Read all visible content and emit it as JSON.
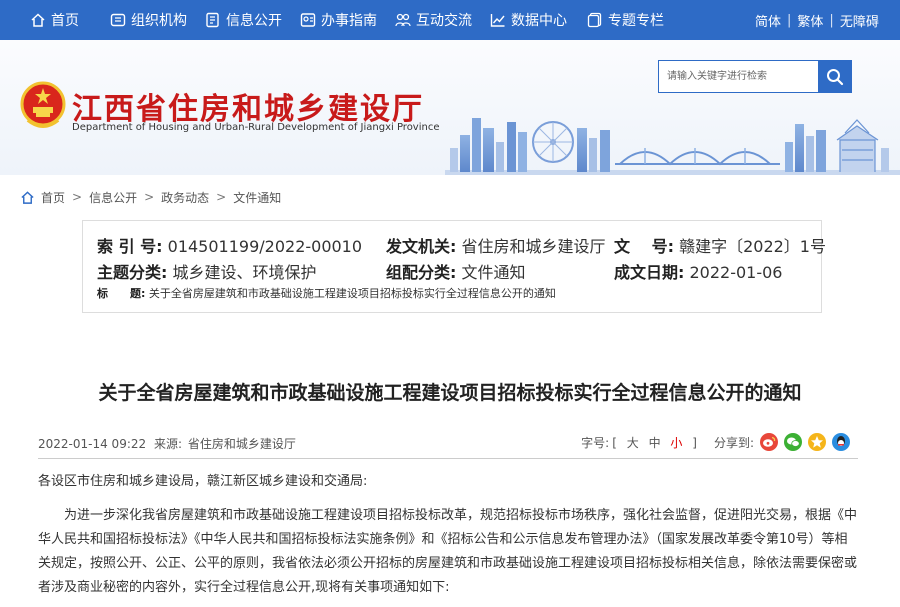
{
  "nav": {
    "items": [
      {
        "label": "首页",
        "icon": "home-icon"
      },
      {
        "label": "组织机构",
        "icon": "org-icon"
      },
      {
        "label": "信息公开",
        "icon": "document-icon"
      },
      {
        "label": "办事指南",
        "icon": "guide-icon"
      },
      {
        "label": "互动交流",
        "icon": "interact-icon"
      },
      {
        "label": "数据中心",
        "icon": "chart-icon"
      },
      {
        "label": "专题专栏",
        "icon": "topic-icon"
      }
    ],
    "lang": {
      "simplified": "简体",
      "traditional": "繁体",
      "accessible": "无障碍"
    },
    "accent": "#2e6bc6"
  },
  "header": {
    "title": "江西省住房和城乡建设厅",
    "subtitle": "Department of Housing and Urban-Rural Development of Jiangxi Province",
    "search_placeholder": "请输入关键字进行检索",
    "title_color": "#c81a1a"
  },
  "breadcrumb": [
    "首页",
    "信息公开",
    "政务动态",
    "文件通知"
  ],
  "info": {
    "index_label": "索 引 号:",
    "index_value": "014501199/2022-00010",
    "issuer_label": "发文机关:",
    "issuer_value": "省住房和城乡建设厅",
    "docno_label": "文　 号:",
    "docno_value": "赣建字〔2022〕1号",
    "topic_label": "主题分类:",
    "topic_value": "城乡建设、环境保护",
    "orgtype_label": "组配分类:",
    "orgtype_value": "文件通知",
    "date_label": "成文日期:",
    "date_value": "2022-01-06",
    "subject_label": "标　　题:",
    "subject_value": "关于全省房屋建筑和市政基础设施工程建设项目招标投标实行全过程信息公开的通知"
  },
  "article": {
    "title": "关于全省房屋建筑和市政基础设施工程建设项目招标投标实行全过程信息公开的通知",
    "datetime": "2022-01-14 09:22",
    "source_label": "来源:",
    "source_value": "省住房和城乡建设厅",
    "font_label": "字号:",
    "font_open": "[",
    "font_large": "大",
    "font_medium": "中",
    "font_small": "小",
    "font_close": "]",
    "share_label": "分享到:",
    "share_icons": [
      "weibo-icon",
      "wechat-icon",
      "qzone-icon",
      "qq-icon"
    ],
    "salutation": "各设区市住房和城乡建设局，赣江新区城乡建设和交通局:",
    "paragraph1": "为进一步深化我省房屋建筑和市政基础设施工程建设项目招标投标改革，规范招标投标市场秩序，强化社会监督，促进阳光交易，根据《中华人民共和国招标投标法》《中华人民共和国招标投标法实施条例》和《招标公告和公示信息发布管理办法》（国家发展改革委令第10号）等相关规定，按照公开、公正、公平的原则，我省依法必须公开招标的房屋建筑和市政基础设施工程建设项目招标投标相关信息，除依法需要保密或者涉及商业秘密的内容外，实行全过程信息公开,现将有关事项通知如下:"
  }
}
